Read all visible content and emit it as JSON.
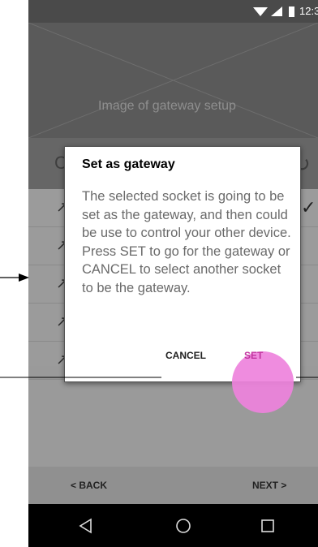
{
  "status_bar": {
    "time": "12:3"
  },
  "hero": {
    "caption": "Image of gateway setup"
  },
  "toolbar": {
    "left_glyph": "C",
    "refresh_icon": "refresh-icon"
  },
  "list": {
    "items": [
      {
        "icon": "socket-icon",
        "checked": true
      },
      {
        "icon": "socket-icon",
        "checked": false
      },
      {
        "icon": "socket-icon",
        "checked": false
      },
      {
        "icon": "socket-icon",
        "checked": false
      },
      {
        "icon": "socket-icon",
        "checked": false
      }
    ]
  },
  "dialog": {
    "title": "Set as gateway",
    "body": "The selected socket is going to be set as the gateway, and then could be use to control your other device. Press SET to go for the gateway or CANCEL to select another socket to be the gateway.",
    "cancel_label": "CANCEL",
    "set_label": "SET"
  },
  "navigation": {
    "back_label": "< BACK",
    "next_label": "NEXT >"
  },
  "colors": {
    "tap_highlight": "#ee82dc",
    "screen_dim": "#9a9a9a"
  }
}
